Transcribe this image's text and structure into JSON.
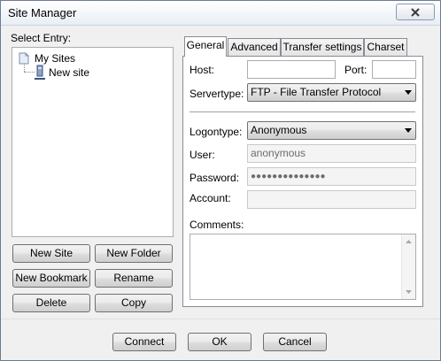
{
  "window": {
    "title": "Site Manager"
  },
  "left": {
    "select_entry_label": "Select Entry:",
    "tree": {
      "root": "My Sites",
      "child": "New site"
    },
    "buttons": {
      "new_site": "New Site",
      "new_folder": "New Folder",
      "new_bookmark": "New Bookmark",
      "rename": "Rename",
      "delete": "Delete",
      "copy": "Copy"
    }
  },
  "tabs": [
    "General",
    "Advanced",
    "Transfer settings",
    "Charset"
  ],
  "general": {
    "host_label": "Host:",
    "host_value": "",
    "port_label": "Port:",
    "port_value": "",
    "servertype_label": "Servertype:",
    "servertype_value": "FTP - File Transfer Protocol",
    "logontype_label": "Logontype:",
    "logontype_value": "Anonymous",
    "user_label": "User:",
    "user_value": "anonymous",
    "password_label": "Password:",
    "password_value": "●●●●●●●●●●●●●●",
    "account_label": "Account:",
    "account_value": "",
    "comments_label": "Comments:",
    "comments_value": ""
  },
  "footer": {
    "connect": "Connect",
    "ok": "OK",
    "cancel": "Cancel"
  },
  "icons": {
    "close": "close-icon",
    "folder": "folder-icon",
    "site": "server-icon",
    "dropdown": "chevron-down-icon"
  }
}
